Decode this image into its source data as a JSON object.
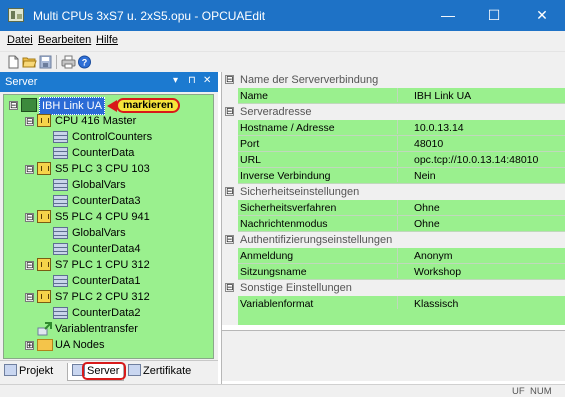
{
  "window": {
    "title": "Multi CPUs 3xS7 u. 2xS5.opu - OPCUAEdit",
    "minimize_glyph": "—",
    "maximize_glyph": "☐",
    "close_glyph": "✕"
  },
  "menu": [
    "Datei",
    "Bearbeiten",
    "Hilfe"
  ],
  "toolbar": {
    "icons": [
      "new-document-icon",
      "open-folder-icon",
      "save-icon",
      "print-icon",
      "help-icon"
    ]
  },
  "server_pane": {
    "title": "Server",
    "dropdown_glyph": "▾",
    "pin_glyph": "⊓",
    "close_glyph": "✕",
    "tree": [
      {
        "label": "IBH Link UA",
        "icon": "server-icon",
        "level": 0,
        "expander": "⊟",
        "selected": true
      },
      {
        "label": "CPU 416 Master",
        "icon": "cpu-icon",
        "level": 1,
        "expander": "⊟"
      },
      {
        "label": "ControlCounters",
        "icon": "table-icon",
        "level": 2
      },
      {
        "label": "CounterData",
        "icon": "table-icon",
        "level": 2
      },
      {
        "label": "S5 PLC 3 CPU 103",
        "icon": "cpu-icon",
        "level": 1,
        "expander": "⊟"
      },
      {
        "label": "GlobalVars",
        "icon": "table-icon",
        "level": 2
      },
      {
        "label": "CounterData3",
        "icon": "table-icon",
        "level": 2
      },
      {
        "label": "S5 PLC 4 CPU 941",
        "icon": "cpu-icon",
        "level": 1,
        "expander": "⊟"
      },
      {
        "label": "GlobalVars",
        "icon": "table-icon",
        "level": 2
      },
      {
        "label": "CounterData4",
        "icon": "table-icon",
        "level": 2
      },
      {
        "label": "S7 PLC 1 CPU 312",
        "icon": "cpu-icon",
        "level": 1,
        "expander": "⊟"
      },
      {
        "label": "CounterData1",
        "icon": "table-icon",
        "level": 2
      },
      {
        "label": "S7 PLC 2 CPU 312",
        "icon": "cpu-icon",
        "level": 1,
        "expander": "⊟"
      },
      {
        "label": "CounterData2",
        "icon": "table-icon",
        "level": 2
      },
      {
        "label": "Variablentransfer",
        "icon": "transfer-icon",
        "level": 1
      },
      {
        "label": "UA Nodes",
        "icon": "folder-icon",
        "level": 1,
        "expander": "⊞"
      }
    ],
    "callout": "markieren"
  },
  "tabs": [
    {
      "label": "Projekt",
      "icon": "project-icon"
    },
    {
      "label": "Server",
      "icon": "server-tab-icon",
      "active": true
    },
    {
      "label": "Zertifikate",
      "icon": "certificate-icon"
    }
  ],
  "properties": [
    {
      "category": "Name der Serververbindung",
      "rows": [
        {
          "name": "Name",
          "value": "IBH Link UA"
        }
      ]
    },
    {
      "category": "Serveradresse",
      "rows": [
        {
          "name": "Hostname / Adresse",
          "value": "10.0.13.14"
        },
        {
          "name": "Port",
          "value": "48010"
        },
        {
          "name": "URL",
          "value": "opc.tcp://10.0.13.14:48010"
        },
        {
          "name": "Inverse Verbindung",
          "value": "Nein"
        }
      ]
    },
    {
      "category": "Sicherheitseinstellungen",
      "rows": [
        {
          "name": "Sicherheitsverfahren",
          "value": "Ohne"
        },
        {
          "name": "Nachrichtenmodus",
          "value": "Ohne"
        }
      ]
    },
    {
      "category": "Authentifizierungseinstellungen",
      "rows": [
        {
          "name": "Anmeldung",
          "value": "Anonym"
        },
        {
          "name": "Sitzungsname",
          "value": "Workshop"
        }
      ]
    },
    {
      "category": "Sonstige Einstellungen",
      "rows": [
        {
          "name": "Variablenformat",
          "value": "Klassisch"
        }
      ]
    }
  ],
  "category_glyph": "⊟",
  "status": {
    "uf": "UF",
    "num": "NUM"
  },
  "colors": {
    "accent": "#1e72c6",
    "tree_background": "#9af08e",
    "highlight": "#d81a1a",
    "callout_fill": "#f5e43a"
  }
}
